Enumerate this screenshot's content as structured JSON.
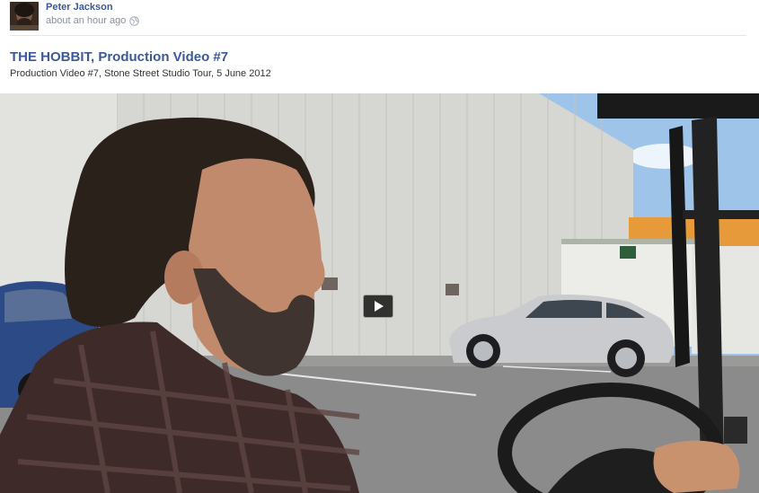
{
  "post": {
    "author": "Peter Jackson",
    "timestamp": "about an hour ago",
    "privacy_icon": "globe-icon"
  },
  "video": {
    "title": "THE HOBBIT, Production Video #7",
    "description": "Production Video #7, Stone Street Studio Tour, 5 June 2012",
    "play_icon": "play-icon"
  },
  "colors": {
    "link": "#3b5998",
    "meta": "#898f9c"
  }
}
